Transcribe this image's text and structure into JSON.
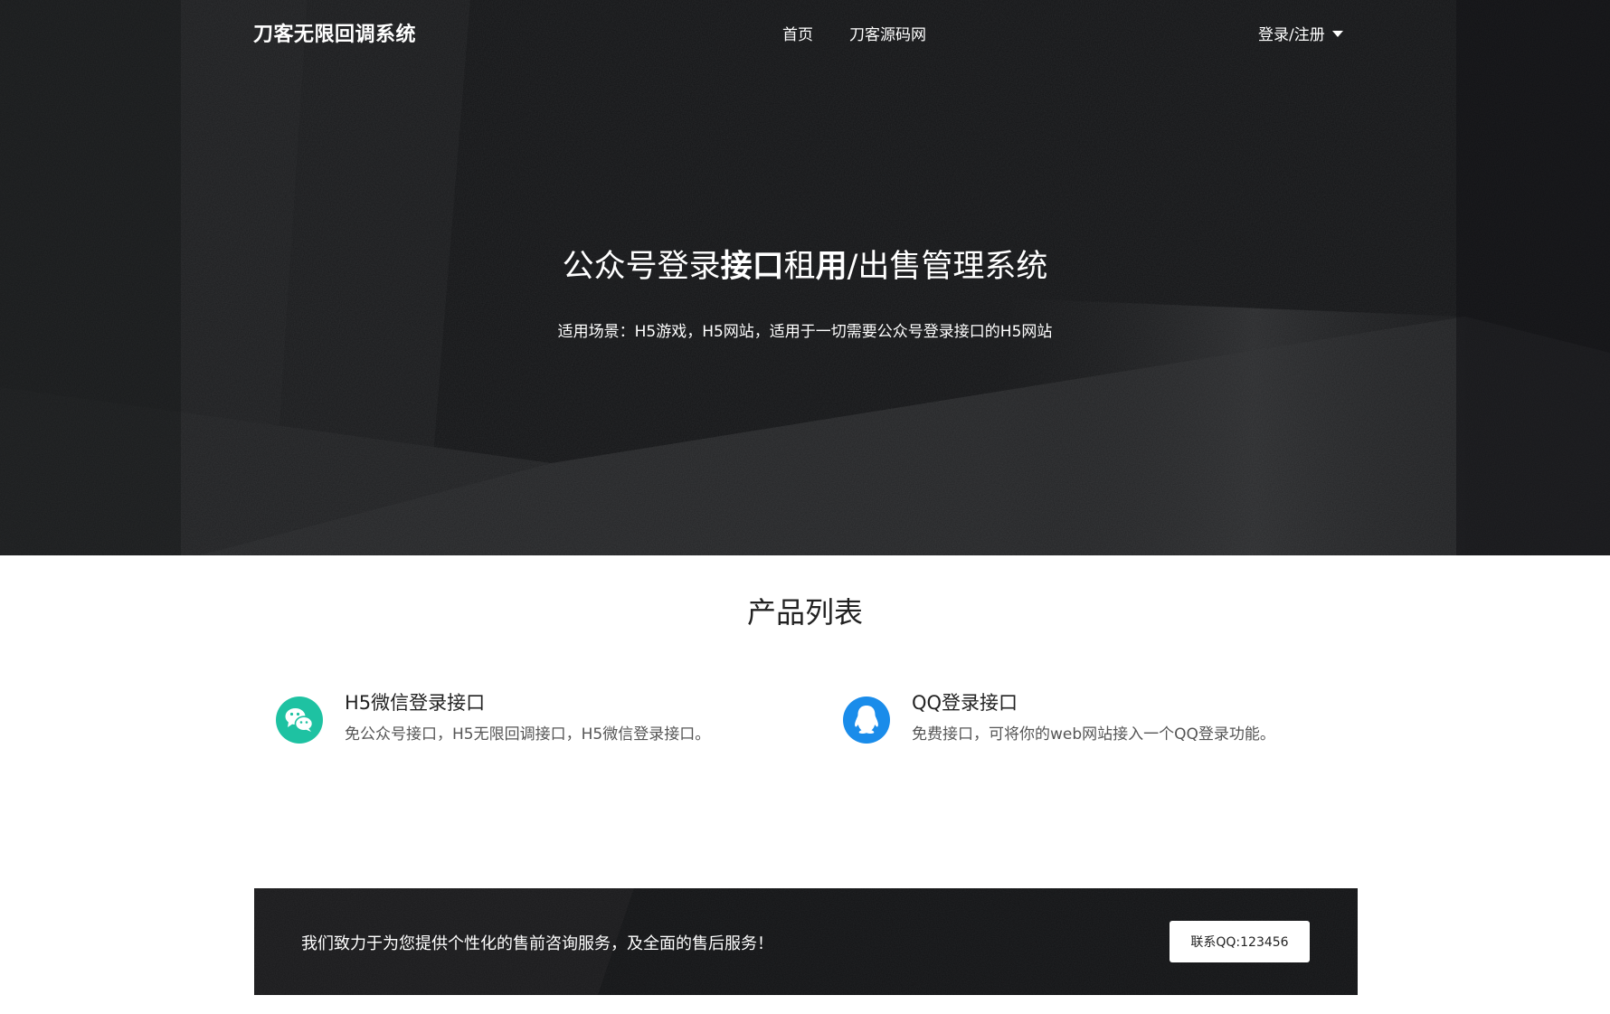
{
  "nav": {
    "brand": "刀客无限回调系统",
    "links": [
      "首页",
      "刀客源码网"
    ],
    "login_label": "登录/注册"
  },
  "hero": {
    "title_part1": "公众号登录",
    "title_bold1": "接口",
    "title_part2": "租",
    "title_bold2": "用",
    "title_part3": "/出售管理系统",
    "subtitle": "适用场景：H5游戏，H5网站，适用于一切需要公众号登录接口的H5网站"
  },
  "products": {
    "section_title": "产品列表",
    "items": [
      {
        "title": "H5微信登录接口",
        "desc": "免公众号接口，H5无限回调接口，H5微信登录接口。",
        "icon": "wechat-icon",
        "color": "#1ec2a2"
      },
      {
        "title": "QQ登录接口",
        "desc": "免费接口，可将你的web网站接入一个QQ登录功能。",
        "icon": "qq-icon",
        "color": "#1a8cea"
      }
    ]
  },
  "cta": {
    "text": "我们致力于为您提供个性化的售前咨询服务，及全面的售后服务！",
    "button_label": "联系QQ:123456"
  },
  "colors": {
    "hero_bg": "#121315",
    "wechat_green": "#1ec2a2",
    "qq_blue": "#1a8cea"
  }
}
